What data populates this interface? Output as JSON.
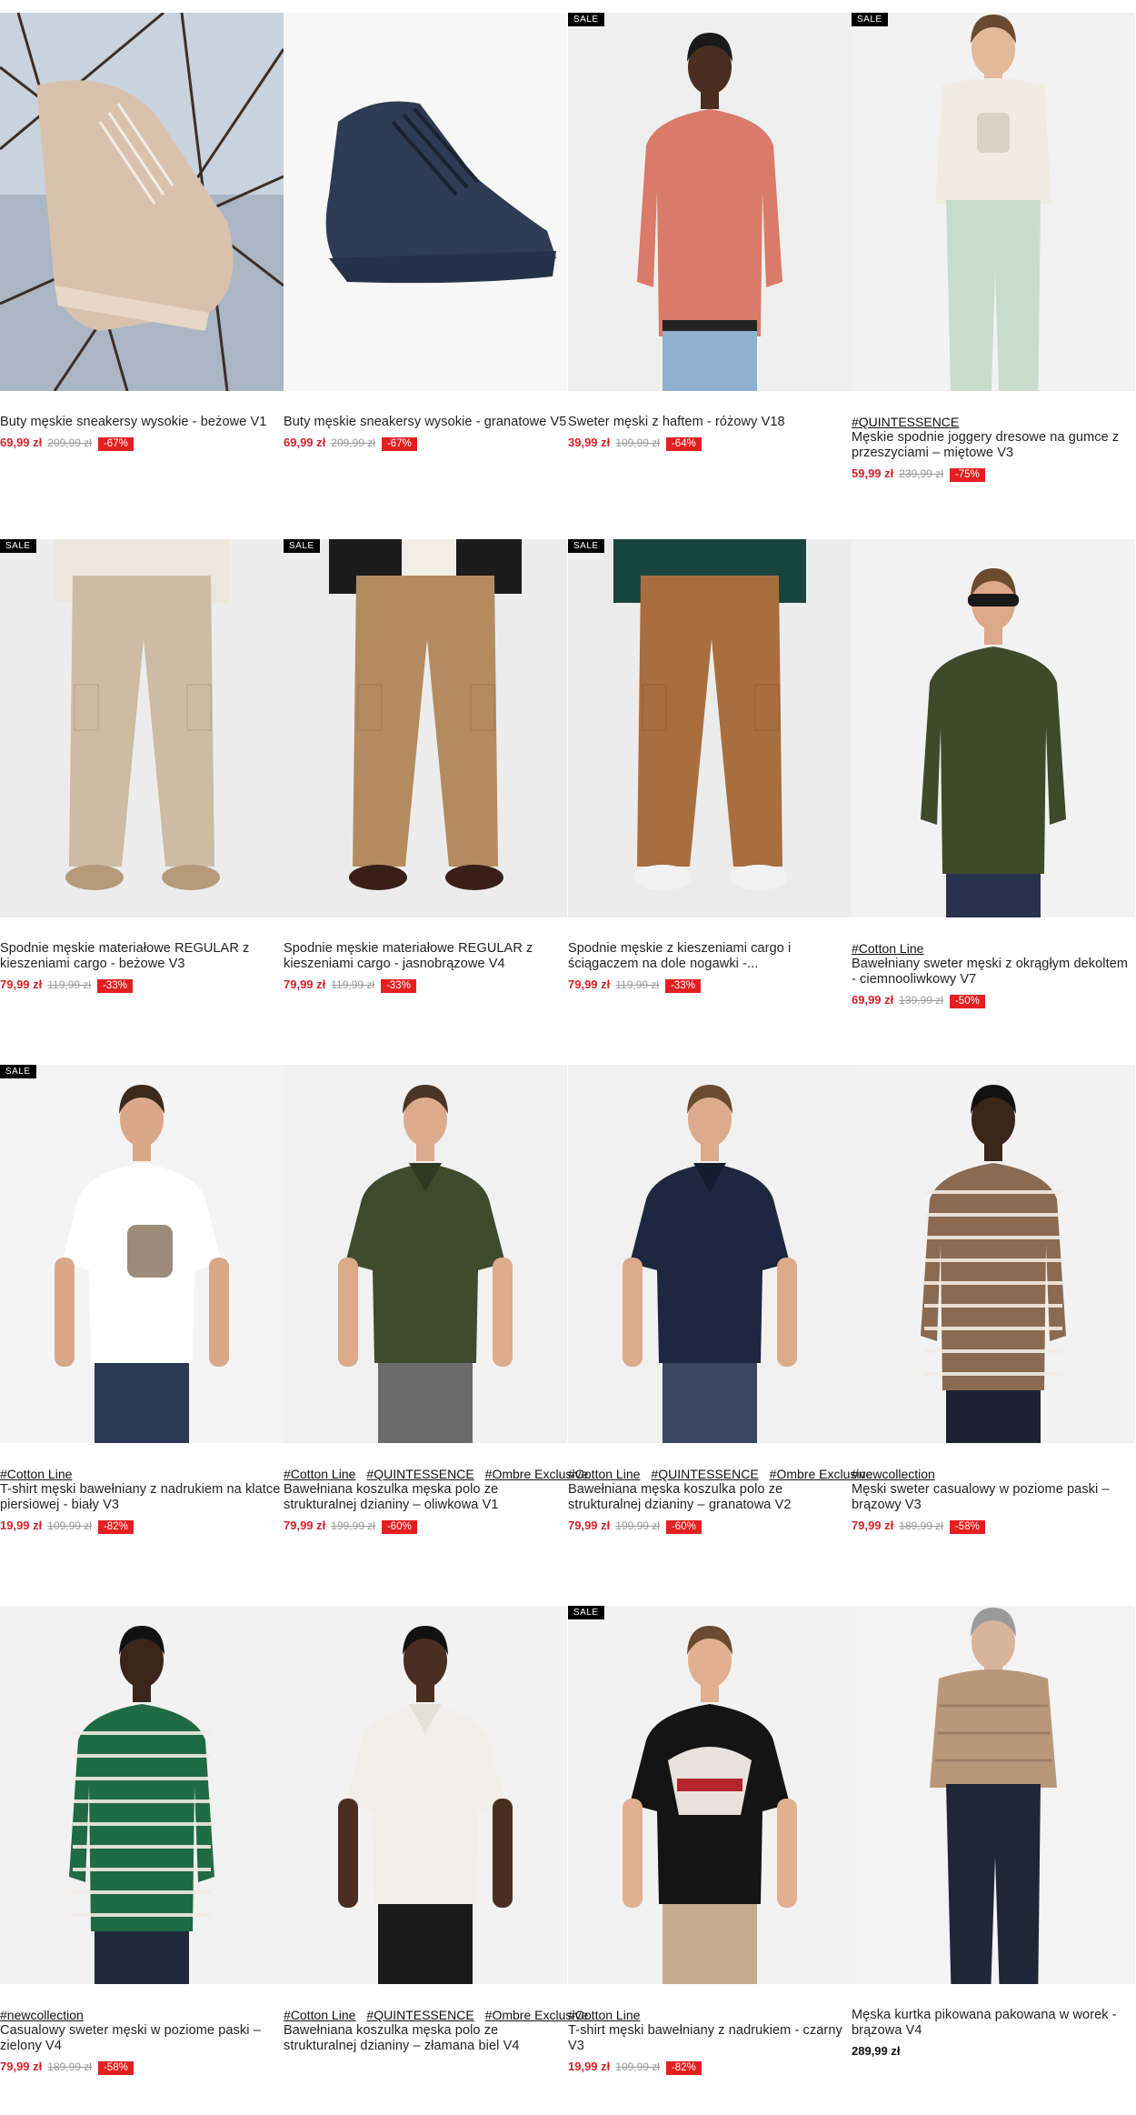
{
  "sale_label": "SALE",
  "colors": {
    "price_sale": "#d2232a",
    "discount_bg": "#e51f1f",
    "badge_bg": "#000000"
  },
  "products": [
    {
      "tags": [],
      "title": "Buty męskie sneakersy wysokie - beżowe V1",
      "price": "69,99 zł",
      "old_price": "209,99 zł",
      "discount": "-67%",
      "sale": false,
      "image": "beige-high-top-sneaker"
    },
    {
      "tags": [],
      "title": "Buty męskie sneakersy wysokie - granatowe V5",
      "price": "69,99 zł",
      "old_price": "209,99 zł",
      "discount": "-67%",
      "sale": false,
      "image": "navy-high-top-sneaker"
    },
    {
      "tags": [],
      "title": "Sweter męski z haftem - różowy V18",
      "price": "39,99 zł",
      "old_price": "109,99 zł",
      "discount": "-64%",
      "sale": true,
      "image": "model-pink-sweater"
    },
    {
      "tags": [
        "#QUINTESSENCE"
      ],
      "title": "Męskie spodnie joggery dresowe na gumce z przeszyciami – miętowe V3",
      "price": "59,99 zł",
      "old_price": "239,99 zł",
      "discount": "-75%",
      "sale": true,
      "image": "model-mint-joggers"
    },
    {
      "tags": [],
      "title": "Spodnie męskie materiałowe REGULAR z kieszeniami cargo - beżowe V3",
      "price": "79,99 zł",
      "old_price": "119,99 zł",
      "discount": "-33%",
      "sale": true,
      "image": "beige-cargo-pants"
    },
    {
      "tags": [],
      "title": "Spodnie męskie materiałowe REGULAR z kieszeniami cargo - jasnobrązowe V4",
      "price": "79,99 zł",
      "old_price": "119,99 zł",
      "discount": "-33%",
      "sale": true,
      "image": "light-brown-cargo-pants"
    },
    {
      "tags": [],
      "title": "Spodnie męskie z kieszeniami cargo i ściągaczem na dole nogawki -...",
      "price": "79,99 zł",
      "old_price": "119,99 zł",
      "discount": "-33%",
      "sale": true,
      "image": "brown-jogger-cargo-pants"
    },
    {
      "tags": [
        "#Cotton Line"
      ],
      "title": "Bawełniany sweter męski z okrągłym dekoltem - ciemnooliwkowy V7",
      "price": "69,99 zł",
      "old_price": "139,99 zł",
      "discount": "-50%",
      "sale": false,
      "image": "model-olive-sweater"
    },
    {
      "tags": [
        "#Cotton Line"
      ],
      "title": "T-shirt męski bawełniany z nadrukiem na klatce piersiowej - biały V3",
      "price": "19,99 zł",
      "old_price": "109,99 zł",
      "discount": "-82%",
      "sale": true,
      "image": "model-white-tshirt"
    },
    {
      "tags": [
        "#Cotton Line",
        "#QUINTESSENCE",
        "#Ombre Exclusive"
      ],
      "title": "Bawełniana koszulka męska polo ze strukturalnej dzianiny – oliwkowa V1",
      "price": "79,99 zł",
      "old_price": "199,99 zł",
      "discount": "-60%",
      "sale": false,
      "image": "model-olive-polo"
    },
    {
      "tags": [
        "#Cotton Line",
        "#QUINTESSENCE",
        "#Ombre Exclusive"
      ],
      "title": "Bawełniana męska koszulka polo ze strukturalnej dzianiny – granatowa V2",
      "price": "79,99 zł",
      "old_price": "199,99 zł",
      "discount": "-60%",
      "sale": false,
      "image": "model-navy-polo"
    },
    {
      "tags": [
        "#newcollection"
      ],
      "title": "Męski sweter casualowy w poziome paski – brązowy V3",
      "price": "79,99 zł",
      "old_price": "189,99 zł",
      "discount": "-58%",
      "sale": false,
      "image": "model-brown-striped-sweater"
    },
    {
      "tags": [
        "#newcollection"
      ],
      "title": "Casualowy sweter męski w poziome paski – zielony V4",
      "price": "79,99 zł",
      "old_price": "189,99 zł",
      "discount": "-58%",
      "sale": false,
      "image": "model-green-striped-sweater"
    },
    {
      "tags": [
        "#Cotton Line",
        "#QUINTESSENCE",
        "#Ombre Exclusive"
      ],
      "title": "Bawełniana koszulka męska polo ze strukturalnej dzianiny – złamana biel V4",
      "price": "",
      "old_price": "",
      "discount": "",
      "sale": false,
      "image": "model-offwhite-polo"
    },
    {
      "tags": [
        "#Cotton Line"
      ],
      "title": "T-shirt męski bawełniany z nadrukiem - czarny V3",
      "price": "19,99 zł",
      "old_price": "109,99 zł",
      "discount": "-82%",
      "sale": true,
      "image": "model-black-print-tshirt"
    },
    {
      "tags": [],
      "title": "Męska kurtka pikowana pakowana w worek - brązowa V4",
      "price": "289,99 zł",
      "old_price": "",
      "discount": "",
      "sale": false,
      "image": "model-brown-puffer-jacket"
    }
  ]
}
